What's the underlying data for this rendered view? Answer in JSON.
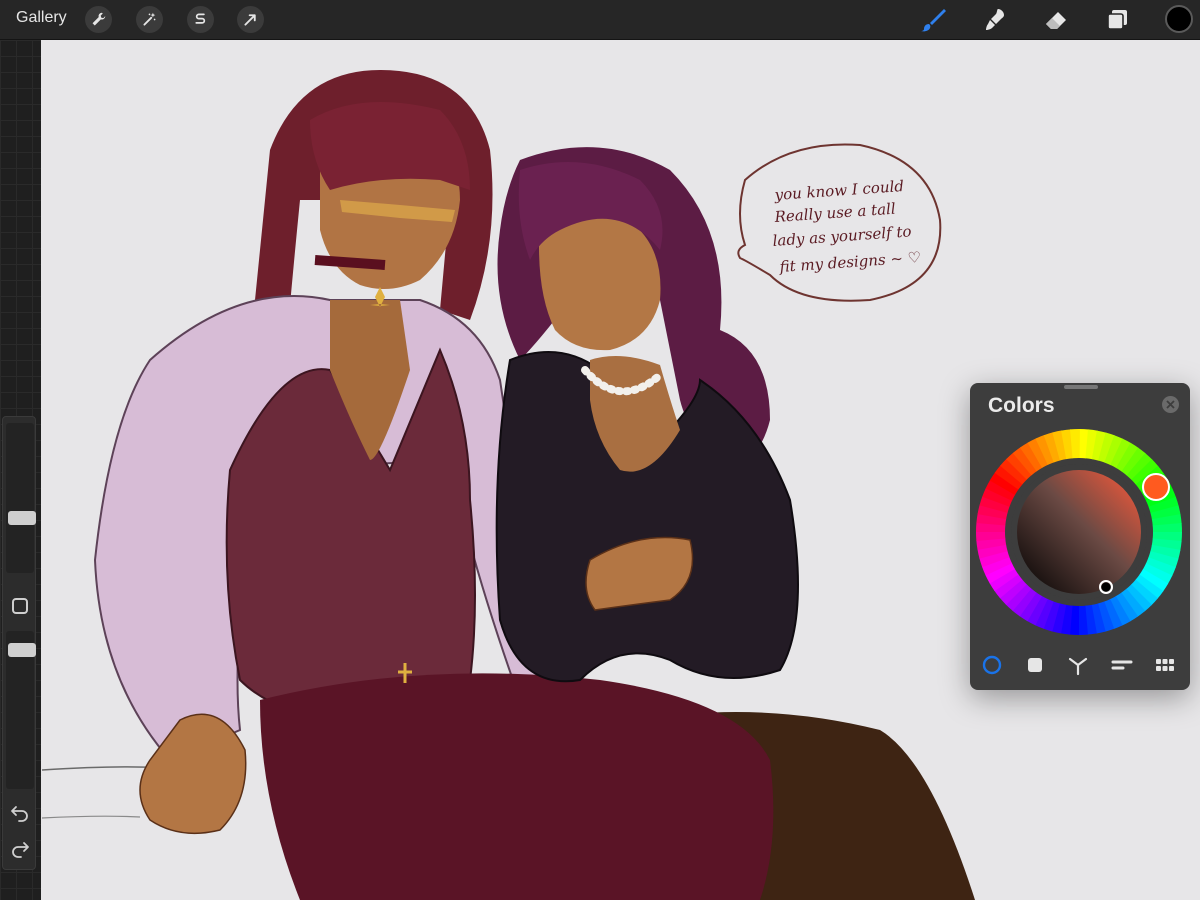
{
  "app": {
    "gallery_label": "Gallery"
  },
  "toolbar_left": [
    {
      "icon": "wrench-icon"
    },
    {
      "icon": "magic-wand-icon"
    },
    {
      "icon": "selection-s-icon"
    },
    {
      "icon": "transform-arrow-icon"
    }
  ],
  "toolbar_right": [
    {
      "icon": "brush-icon",
      "active": true
    },
    {
      "icon": "smudge-icon"
    },
    {
      "icon": "eraser-icon"
    },
    {
      "icon": "layers-icon"
    }
  ],
  "current_color": "#000000",
  "accent_color": "#1a73e8",
  "sidebar": {
    "brush_size_level": 0.35,
    "opacity_level": 0.6,
    "buttons": [
      "modify-icon",
      "undo-icon",
      "redo-icon"
    ]
  },
  "colors_panel": {
    "title": "Colors",
    "selected_hue_color": "#ff5a1f",
    "modes": [
      "disc",
      "classic",
      "harmony",
      "value",
      "palettes"
    ],
    "active_mode": "disc"
  },
  "speech_bubble": {
    "lines": [
      "you know I could",
      "Really use a tall",
      "lady as yourself to",
      "fit my designs ~ ♡"
    ]
  }
}
